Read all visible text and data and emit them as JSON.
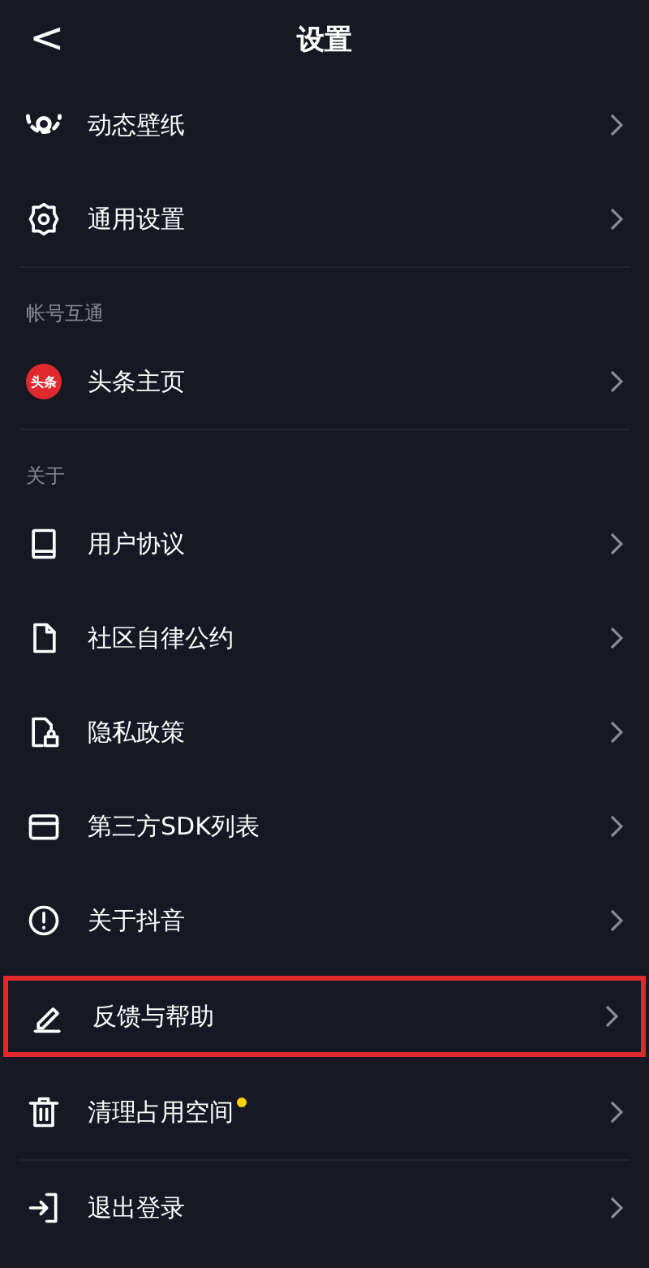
{
  "header": {
    "back": "<",
    "title": "设置"
  },
  "sections": [
    {
      "items": [
        {
          "label": "动态壁纸",
          "dot": false,
          "highlighted": false
        },
        {
          "label": "通用设置",
          "dot": false,
          "highlighted": false
        }
      ]
    },
    {
      "label": "帐号互通",
      "items": [
        {
          "logo_text": "头条",
          "label": "头条主页",
          "dot": false,
          "highlighted": false
        }
      ]
    },
    {
      "label": "关于",
      "items": [
        {
          "label": "用户协议",
          "dot": false,
          "highlighted": false
        },
        {
          "label": "社区自律公约",
          "dot": false,
          "highlighted": false
        },
        {
          "label": "隐私政策",
          "dot": false,
          "highlighted": false
        },
        {
          "label": "第三方SDK列表",
          "dot": false,
          "highlighted": false
        },
        {
          "label": "关于抖音",
          "dot": false,
          "highlighted": false
        },
        {
          "label": "反馈与帮助",
          "dot": false,
          "highlighted": true
        },
        {
          "label": "清理占用空间",
          "dot": true,
          "highlighted": false
        }
      ]
    },
    {
      "items": [
        {
          "label": "退出登录",
          "dot": false,
          "highlighted": false
        }
      ]
    }
  ]
}
